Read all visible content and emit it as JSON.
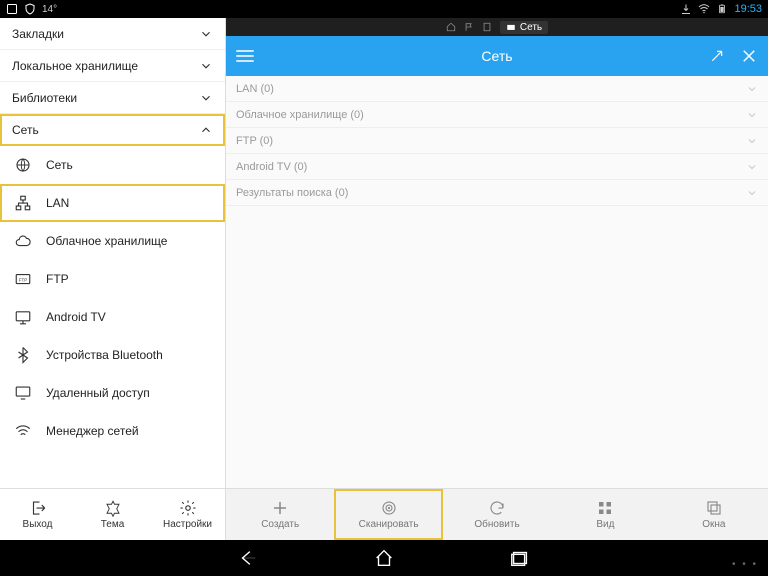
{
  "status": {
    "temp": "14°",
    "clock": "19:53"
  },
  "sidebar": {
    "sections": [
      {
        "label": "Закладки"
      },
      {
        "label": "Локальное хранилище"
      },
      {
        "label": "Библиотеки"
      },
      {
        "label": "Сеть"
      }
    ],
    "net_items": [
      {
        "label": "Сеть"
      },
      {
        "label": "LAN"
      },
      {
        "label": "Облачное хранилище"
      },
      {
        "label": "FTP"
      },
      {
        "label": "Android TV"
      },
      {
        "label": "Устройства Bluetooth"
      },
      {
        "label": "Удаленный доступ"
      },
      {
        "label": "Менеджер сетей"
      }
    ],
    "bottom": [
      {
        "label": "Выход"
      },
      {
        "label": "Тема"
      },
      {
        "label": "Настройки"
      }
    ]
  },
  "main": {
    "crumb_label": "Сеть",
    "title": "Сеть",
    "rows": [
      {
        "label": "LAN (0)"
      },
      {
        "label": "Облачное хранилище (0)"
      },
      {
        "label": "FTP (0)"
      },
      {
        "label": "Android TV (0)"
      },
      {
        "label": "Результаты поиска (0)"
      }
    ],
    "toolbar": [
      {
        "label": "Создать"
      },
      {
        "label": "Сканировать"
      },
      {
        "label": "Обновить"
      },
      {
        "label": "Вид"
      },
      {
        "label": "Окна"
      }
    ]
  }
}
